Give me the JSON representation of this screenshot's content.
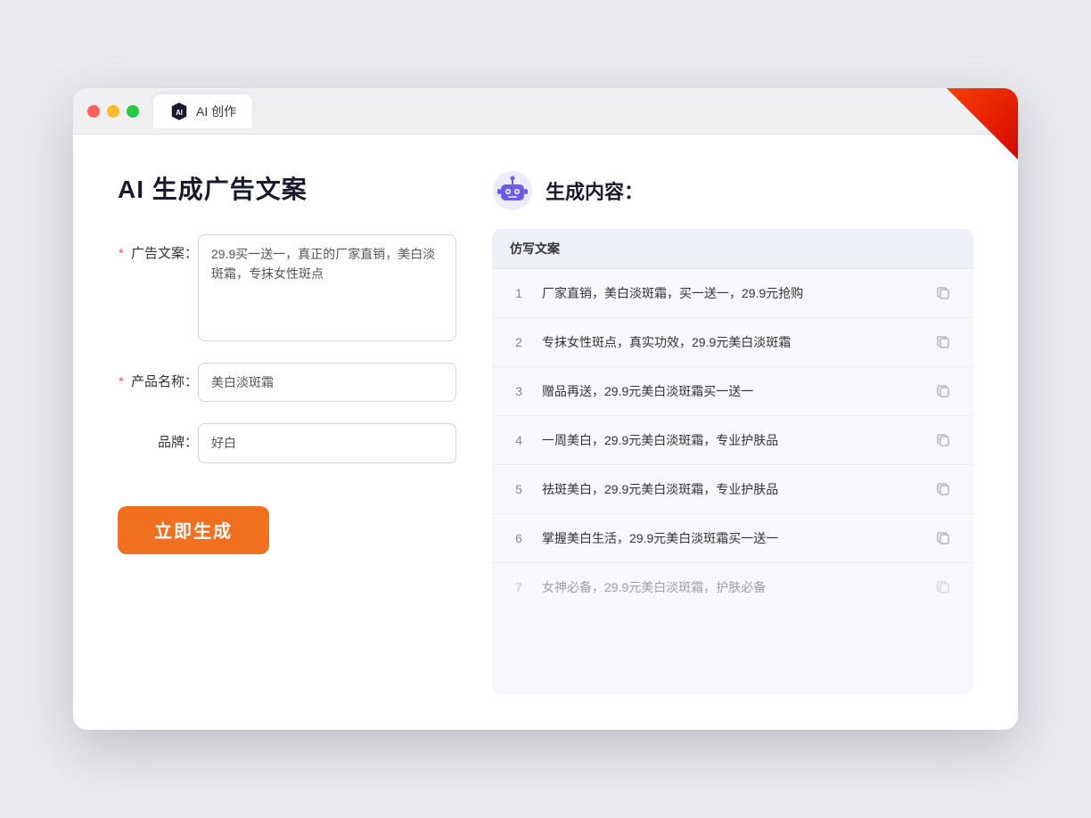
{
  "browser": {
    "tab_label": "AI 创作",
    "traffic_lights": [
      "red",
      "yellow",
      "green"
    ]
  },
  "left_panel": {
    "title": "AI 生成广告文案",
    "fields": [
      {
        "label": "广告文案：",
        "required": true,
        "type": "textarea",
        "value": "29.9买一送一，真正的厂家直销，美白淡斑霜，专抹女性斑点",
        "name": "ad-copy-textarea"
      },
      {
        "label": "产品名称：",
        "required": true,
        "type": "input",
        "value": "美白淡斑霜",
        "name": "product-name-input"
      },
      {
        "label": "品牌：",
        "required": false,
        "type": "input",
        "value": "好白",
        "name": "brand-input"
      }
    ],
    "generate_button": "立即生成"
  },
  "right_panel": {
    "title": "生成内容：",
    "table_header": "仿写文案",
    "results": [
      {
        "num": "1",
        "text": "厂家直销，美白淡斑霜，买一送一，29.9元抢购",
        "faded": false
      },
      {
        "num": "2",
        "text": "专抹女性斑点，真实功效，29.9元美白淡斑霜",
        "faded": false
      },
      {
        "num": "3",
        "text": "赠品再送，29.9元美白淡斑霜买一送一",
        "faded": false
      },
      {
        "num": "4",
        "text": "一周美白，29.9元美白淡斑霜，专业护肤品",
        "faded": false
      },
      {
        "num": "5",
        "text": "祛斑美白，29.9元美白淡斑霜，专业护肤品",
        "faded": false
      },
      {
        "num": "6",
        "text": "掌握美白生活，29.9元美白淡斑霜买一送一",
        "faded": false
      },
      {
        "num": "7",
        "text": "女神必备，29.9元美白淡斑霜，护肤必备",
        "faded": true
      }
    ]
  }
}
